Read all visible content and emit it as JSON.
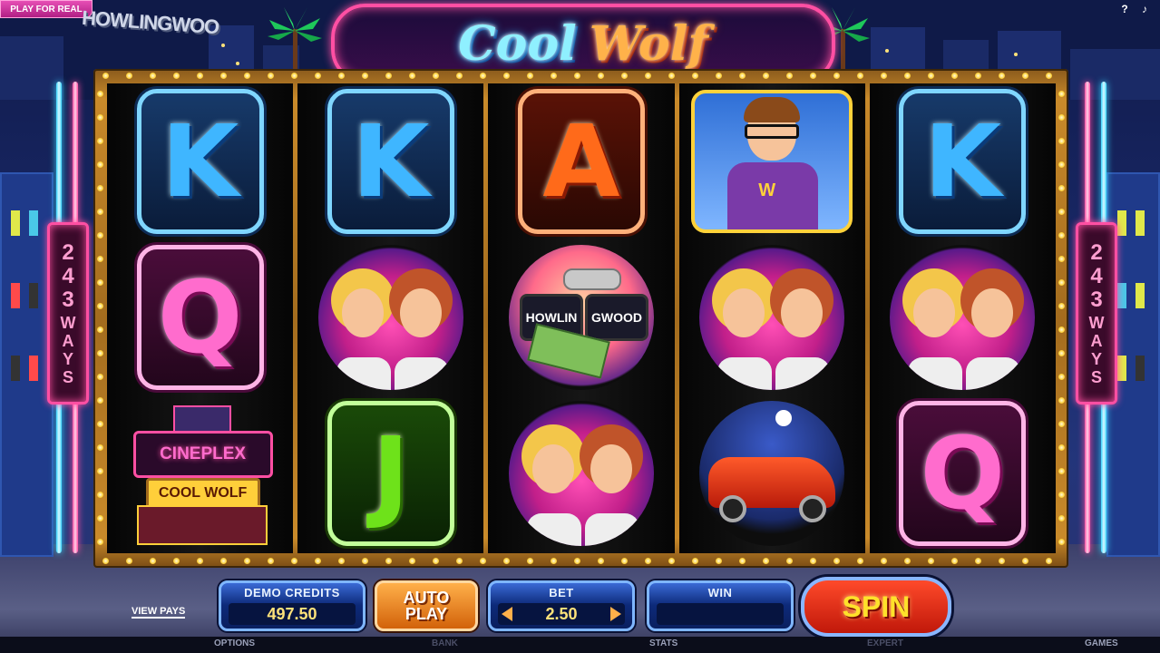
{
  "header": {
    "play_for_real": "PLAY FOR REAL",
    "hollywood_sign": "HOWLINGWOO",
    "logo_part1": "Cool",
    "logo_part2": "Wolf",
    "help": "?",
    "sound": "♪"
  },
  "side_signs": {
    "left_number": "2\n4\n3",
    "left_text": "W\nA\nY\nS",
    "right_number": "2\n4\n3",
    "right_text": "W\nA\nY\nS"
  },
  "reels": [
    [
      "K",
      "Q",
      "Cineplex"
    ],
    [
      "K",
      "Girls",
      "J"
    ],
    [
      "A",
      "Sunglasses",
      "Girls"
    ],
    [
      "Nerd",
      "Girls",
      "Car"
    ],
    [
      "K",
      "Girls",
      "Q"
    ]
  ],
  "symbols": {
    "cineplex_sign": "CINEPLEX",
    "cineplex_marquee": "COOL WOLF",
    "nerd_letter": "W",
    "lens_left": "HOWLIN",
    "lens_right": "GWOOD"
  },
  "controls": {
    "view_pays": "VIEW PAYS",
    "credits_label": "DEMO CREDITS",
    "credits_value": "497.50",
    "autoplay": "AUTO\nPLAY",
    "bet_label": "BET",
    "bet_value": "2.50",
    "win_label": "WIN",
    "win_value": "",
    "spin": "SPIN"
  },
  "footer": {
    "options": "OPTIONS",
    "bank": "BANK",
    "stats": "STATS",
    "expert": "EXPERT",
    "games": "GAMES"
  },
  "colors": {
    "k_symbol": "#3fb6ff",
    "q_symbol": "#ff6ccd",
    "a_symbol": "#ff6a1a",
    "j_symbol": "#6ee21a",
    "neon_pink": "#ff4fa3",
    "frame_gold": "#c98a2a"
  }
}
